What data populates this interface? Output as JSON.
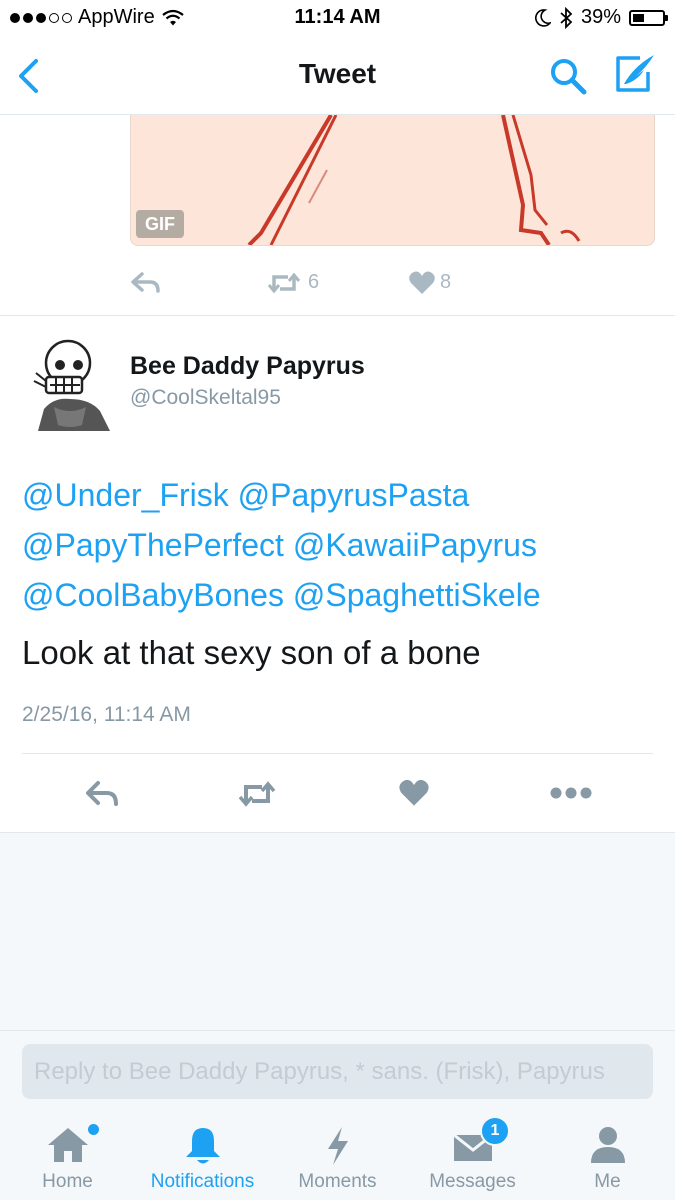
{
  "status_bar": {
    "carrier": "AppWire",
    "time": "11:14 AM",
    "battery": "39%",
    "battery_level": 0.39
  },
  "nav": {
    "title": "Tweet",
    "back_icon": "chevron-left-icon",
    "search_icon": "search-icon",
    "compose_icon": "compose-icon"
  },
  "previous_tweet": {
    "gif_badge": "GIF",
    "retweet_count": "6",
    "like_count": "8"
  },
  "tweet": {
    "display_name": "Bee Daddy Papyrus",
    "handle": "@CoolSkeltal95",
    "mentions": [
      "@Under_Frisk",
      "@PapyrusPasta",
      "@PapyThePerfect",
      "@KawaiiPapyrus",
      "@CoolBabyBones",
      "@SpaghettiSkele"
    ],
    "text": "Look at that sexy son of a bone",
    "timestamp": "2/25/16, 11:14 AM"
  },
  "reply": {
    "placeholder": "Reply to Bee Daddy Papyrus, * sans. (Frisk), Papyrus"
  },
  "tabs": [
    {
      "label": "Home",
      "icon": "home-icon"
    },
    {
      "label": "Notifications",
      "icon": "bell-icon",
      "active": true
    },
    {
      "label": "Moments",
      "icon": "lightning-icon"
    },
    {
      "label": "Messages",
      "icon": "envelope-icon",
      "badge": "1"
    },
    {
      "label": "Me",
      "icon": "person-icon"
    }
  ],
  "colors": {
    "accent": "#1da1f2",
    "icon_gray": "#8899a6",
    "action_gray": "#aab8c2",
    "gif_background": "#fde6d9"
  }
}
